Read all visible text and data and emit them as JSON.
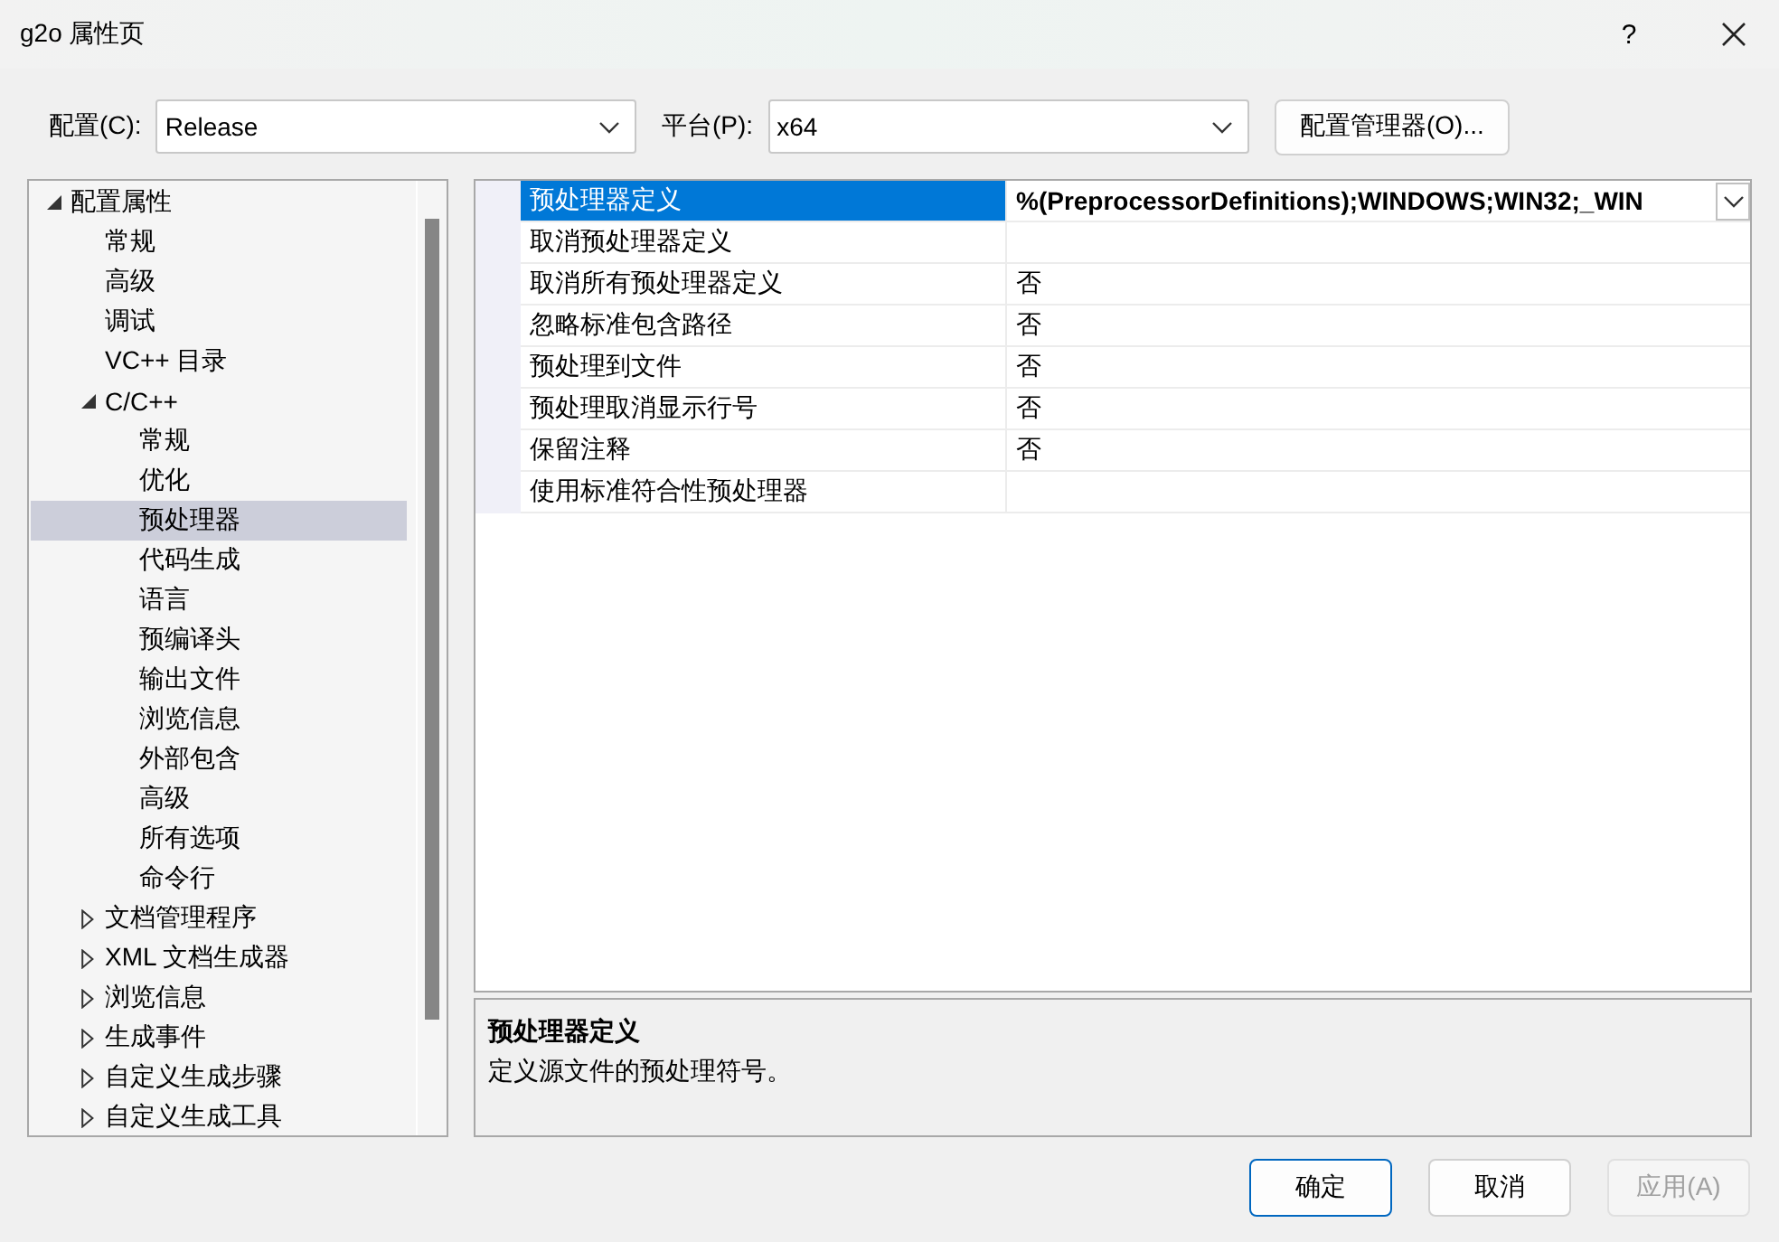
{
  "window": {
    "title": "g2o 属性页",
    "help_button": "?"
  },
  "configuration": {
    "label": "配置(C):",
    "value": "Release"
  },
  "platform": {
    "label": "平台(P):",
    "value": "x64"
  },
  "configuration_manager_button": "配置管理器(O)...",
  "tree": [
    {
      "label": "配置属性",
      "expanded": true,
      "selected": false,
      "children": [
        {
          "label": "常规",
          "selected": false
        },
        {
          "label": "高级",
          "selected": false
        },
        {
          "label": "调试",
          "selected": false
        },
        {
          "label": "VC++ 目录",
          "selected": false
        },
        {
          "label": "C/C++",
          "expanded": true,
          "selected": false,
          "children": [
            {
              "label": "常规",
              "selected": false
            },
            {
              "label": "优化",
              "selected": false
            },
            {
              "label": "预处理器",
              "selected": true
            },
            {
              "label": "代码生成",
              "selected": false
            },
            {
              "label": "语言",
              "selected": false
            },
            {
              "label": "预编译头",
              "selected": false
            },
            {
              "label": "输出文件",
              "selected": false
            },
            {
              "label": "浏览信息",
              "selected": false
            },
            {
              "label": "外部包含",
              "selected": false
            },
            {
              "label": "高级",
              "selected": false
            },
            {
              "label": "所有选项",
              "selected": false
            },
            {
              "label": "命令行",
              "selected": false
            }
          ]
        },
        {
          "label": "文档管理程序",
          "expanded": false,
          "selected": false
        },
        {
          "label": "XML 文档生成器",
          "expanded": false,
          "selected": false
        },
        {
          "label": "浏览信息",
          "expanded": false,
          "selected": false
        },
        {
          "label": "生成事件",
          "expanded": false,
          "selected": false
        },
        {
          "label": "自定义生成步骤",
          "expanded": false,
          "selected": false
        },
        {
          "label": "自定义生成工具",
          "expanded": false,
          "selected": false
        }
      ]
    }
  ],
  "properties": [
    {
      "name": "预处理器定义",
      "value": "%(PreprocessorDefinitions);WINDOWS;WIN32;_WIN",
      "modified": true,
      "selected": true
    },
    {
      "name": "取消预处理器定义",
      "modified": false,
      "selected": false
    },
    {
      "name": "取消所有预处理器定义",
      "value": "否",
      "modified": false,
      "selected": false
    },
    {
      "name": "忽略标准包含路径",
      "value": "否",
      "modified": false,
      "selected": false
    },
    {
      "name": "预处理到文件",
      "value": "否",
      "modified": false,
      "selected": false
    },
    {
      "name": "预处理取消显示行号",
      "value": "否",
      "modified": false,
      "selected": false
    },
    {
      "name": "保留注释",
      "value": "否",
      "modified": false,
      "selected": false
    },
    {
      "name": "使用标准符合性预处理器",
      "modified": false,
      "selected": false
    }
  ],
  "description": {
    "title": "预处理器定义",
    "text": "定义源文件的预处理符号。"
  },
  "buttons": [
    {
      "label": "确定",
      "default": true,
      "disabled": false
    },
    {
      "label": "取消",
      "default": false,
      "disabled": false
    },
    {
      "label": "应用(A)",
      "default": false,
      "disabled": true
    }
  ]
}
